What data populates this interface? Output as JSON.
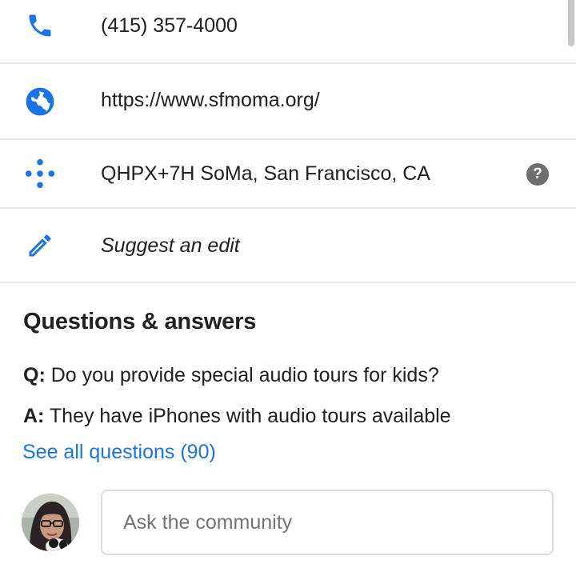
{
  "contact": {
    "phone": "(415) 357-4000",
    "website": "https://www.sfmoma.org/",
    "plus_code": "QHPX+7H SoMa, San Francisco, CA",
    "plus_code_help": "?",
    "suggest_edit": "Suggest an edit"
  },
  "qa": {
    "title": "Questions & answers",
    "question_prefix": "Q:",
    "question_text": "Do you provide special audio tours for kids?",
    "answer_prefix": "A:",
    "answer_text": "They have iPhones with audio tours available",
    "see_all": "See all questions (90)",
    "ask_placeholder": "Ask the community"
  },
  "icons": {
    "phone": "phone-icon",
    "website": "globe-icon",
    "plus_code": "plus-code-icon",
    "help": "help-icon",
    "edit": "pencil-icon",
    "avatar": "user-avatar"
  },
  "colors": {
    "accent": "#1a73e8",
    "text": "#202124",
    "divider": "#e8e8e8",
    "help_icon": "#6f6f6f"
  }
}
